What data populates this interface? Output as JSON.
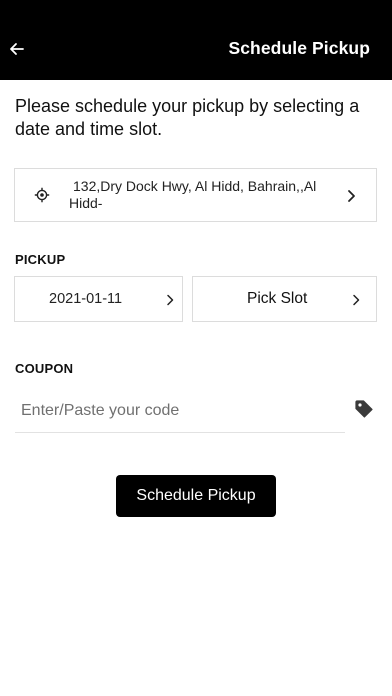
{
  "header": {
    "title": "Schedule Pickup",
    "back_icon": "arrow-left-icon",
    "background": "#000000"
  },
  "intro_text": "Please schedule your pickup by selecting a date and time slot.",
  "address": {
    "text": "132,Dry Dock Hwy, Al Hidd, Bahrain,,Al Hidd-",
    "icon": "location-target-icon",
    "chevron": "chevron-right-icon"
  },
  "pickup": {
    "label": "PICKUP",
    "date": "2021-01-11",
    "slot": "Pick Slot"
  },
  "coupon": {
    "label": "COUPON",
    "placeholder": "Enter/Paste your code",
    "value": "",
    "icon": "tag-icon"
  },
  "action": {
    "label": "Schedule Pickup",
    "background": "#000000"
  }
}
